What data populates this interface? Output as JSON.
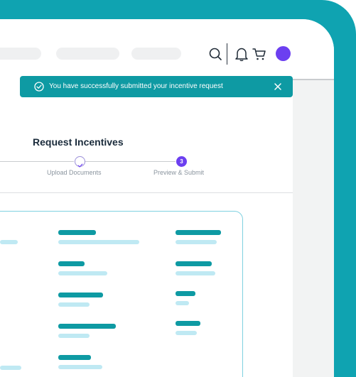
{
  "toast": {
    "message": "You have successfully submitted your incentive request"
  },
  "page": {
    "title": "Request Incentives"
  },
  "steps": [
    {
      "number": "",
      "label": "Upload Documents",
      "state": "done"
    },
    {
      "number": "3",
      "label": "Preview & Submit",
      "state": "active"
    }
  ],
  "colors": {
    "brand": "#0fa3b1",
    "toast": "#0e9aa3",
    "accent": "#6c3ff0",
    "placeholder_dark": "#0e9aa3",
    "placeholder_light": "#bfe9f3"
  },
  "icons": {
    "search": "search-icon",
    "bell": "bell-icon",
    "cart": "cart-icon",
    "success": "check-circle-icon",
    "close": "close-icon",
    "step_done": "check-icon"
  }
}
